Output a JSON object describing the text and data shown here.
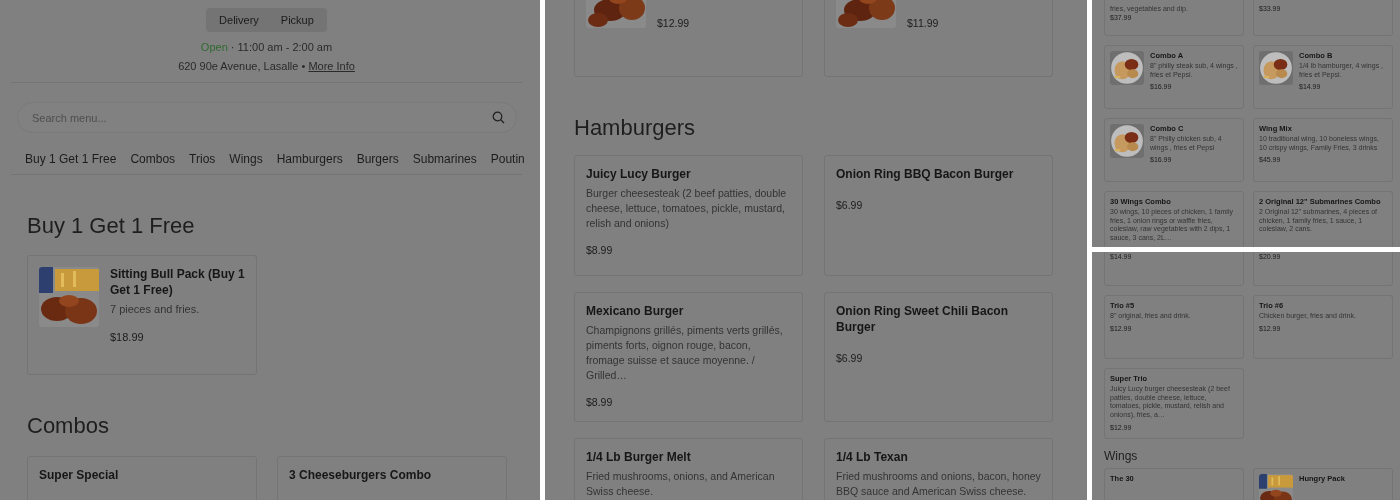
{
  "left_panel": {
    "order_modes": [
      {
        "label": "Delivery"
      },
      {
        "label": "Pickup"
      }
    ],
    "status": "Open",
    "hours": "· 11:00 am - 2:00 am",
    "address": "620 90e Avenue, Lasalle •",
    "info_link": "More Info",
    "search": {
      "placeholder": "Search menu..."
    },
    "categories": [
      "Buy 1 Get 1 Free",
      "Combos",
      "Trios",
      "Wings",
      "Hamburgers",
      "Burgers",
      "Submarines",
      "Poutin"
    ],
    "sections": [
      {
        "heading": "Buy 1 Get 1 Free",
        "items": [
          {
            "name": "Sitting Bull Pack (Buy 1 Get 1 Free)",
            "description": "7 pieces and fries.",
            "price": "$18.99",
            "has_photo": true
          }
        ]
      },
      {
        "heading": "Combos",
        "items": [
          {
            "name": "Super Special"
          },
          {
            "name": "3 Cheeseburgers Combo"
          }
        ]
      }
    ]
  },
  "middle_panel": {
    "sections": [
      {
        "items": [
          {
            "price": "$12.99",
            "has_photo": true
          },
          {
            "price": "$11.99",
            "has_photo": true
          }
        ]
      },
      {
        "heading": "Hamburgers",
        "items": [
          {
            "name": "Juicy Lucy Burger",
            "description": "Burger cheesesteak (2 beef patties, double cheese, lettuce, tomatoes, pickle, mustard, relish and onions)",
            "price": "$8.99"
          },
          {
            "name": "Onion Ring BBQ Bacon Burger",
            "price": "$6.99"
          },
          {
            "name": "Mexicano Burger",
            "description": "Champignons grillés, piments verts grillés, piments forts, oignon rouge, bacon, fromage suisse et sauce moyenne. / Grilled…",
            "price": "$8.99"
          },
          {
            "name": "Onion Ring Sweet Chili Bacon Burger",
            "price": "$6.99"
          },
          {
            "name": "1/4 Lb Burger Melt",
            "description": "Fried mushrooms, onions, and American Swiss cheese."
          },
          {
            "name": "1/4 Lb Texan",
            "description": "Fried mushrooms and onions, bacon, honey BBQ sauce and American Swiss cheese."
          }
        ]
      }
    ]
  },
  "right_panel_top": {
    "sections": [
      {
        "items": [
          {
            "description": "fries, vegetables and dip.",
            "price": "$37.99"
          },
          {
            "price": "$33.99"
          },
          {
            "name": "Combo A",
            "description": "8\" philly steak sub, 4 wings , fries et Pepsi.",
            "price": "$16.99",
            "has_photo": true
          },
          {
            "name": "Combo B",
            "description": "1/4 lb hamburger, 4 wings , fries et Pepsi.",
            "price": "$14.99",
            "has_photo": true
          },
          {
            "name": "Combo C",
            "description": "8\" Philly chicken sub, 4 wings , fries et Pepsi",
            "price": "$16.99",
            "has_photo": true
          },
          {
            "name": "Wing Mix",
            "description": "10 traditional wing, 10 boneless wings, 10 crispy wings, Family Fries, 3 drinks",
            "price": "$45.99"
          },
          {
            "name": "30 Wings Combo",
            "description": "30 wings, 10 pieces of chicken, 1 family fries, 1 onion rings or waffle fries, coleslaw, raw vegetables with 2 dips, 1 sauce, 3 cans, 2L…"
          },
          {
            "name": "2 Original 12\" Submarines Combo",
            "description": "2 Original 12\" submarines, 4 pieces of chicken, 1 family fries, 1 sauce, 1 coleslaw, 2 cans."
          }
        ]
      }
    ]
  },
  "right_panel_bottom": {
    "sections": [
      {
        "items": [
          {
            "price": "$14.99"
          },
          {
            "price": "$20.99"
          },
          {
            "name": "Trio #5",
            "description": "8\" original, fries and drink.",
            "price": "$12.99"
          },
          {
            "name": "Trio #6",
            "description": "Chicken burger, fries and drink.",
            "price": "$12.99"
          },
          {
            "name": "Super Trio",
            "description": "Juicy Lucy burger cheesesteak (2 beef patties, double cheese, lettuce, tomatoes, pickle, mustard, relish and onions), fries, a…",
            "price": "$12.99"
          }
        ]
      },
      {
        "heading": "Wings",
        "items": [
          {
            "name": "The 30"
          },
          {
            "name": "Hungry Pack",
            "has_photo": true
          }
        ]
      }
    ]
  }
}
